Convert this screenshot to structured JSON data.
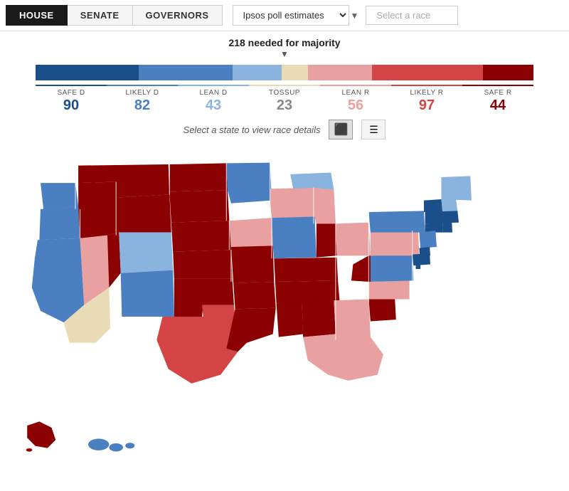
{
  "header": {
    "tabs": [
      {
        "label": "HOUSE",
        "active": true
      },
      {
        "label": "SENATE",
        "active": false
      },
      {
        "label": "GOVERNORS",
        "active": false
      }
    ],
    "poll_select": {
      "value": "Ipsos poll estimates",
      "placeholder": "Ipsos poll estimates"
    },
    "race_select": {
      "placeholder": "Select a race"
    }
  },
  "majority": {
    "label": "218 needed for majority",
    "arrow": "▼"
  },
  "categories": [
    {
      "key": "safe_d",
      "label": "SAFE D",
      "count": "90",
      "color": "#1a4f8a"
    },
    {
      "key": "likely_d",
      "label": "LIKELY D",
      "count": "82",
      "color": "#4a7fc1"
    },
    {
      "key": "lean_d",
      "label": "LEAN D",
      "count": "43",
      "color": "#8ab3de"
    },
    {
      "key": "tossup",
      "label": "TOSSUP",
      "count": "23",
      "color": "#e8dbb5"
    },
    {
      "key": "lean_r",
      "label": "LEAN R",
      "count": "56",
      "color": "#e8a0a0"
    },
    {
      "key": "likely_r",
      "label": "LIKELY R",
      "count": "97",
      "color": "#d44444"
    },
    {
      "key": "safe_r",
      "label": "SAFE R",
      "count": "44",
      "color": "#8b0000"
    }
  ],
  "color_bar": [
    {
      "color": "#1a4f8a",
      "flex": 90
    },
    {
      "color": "#4a7fc1",
      "flex": 82
    },
    {
      "color": "#8ab3de",
      "flex": 43
    },
    {
      "color": "#e8dbb5",
      "flex": 23
    },
    {
      "color": "#e8a0a0",
      "flex": 56
    },
    {
      "color": "#d44444",
      "flex": 97
    },
    {
      "color": "#8b0000",
      "flex": 44
    }
  ],
  "map_hint": "Select a state to view race details",
  "view_buttons": [
    {
      "label": "🗺",
      "icon": "map-icon",
      "active": true
    },
    {
      "label": "☰",
      "icon": "list-icon",
      "active": false
    }
  ]
}
